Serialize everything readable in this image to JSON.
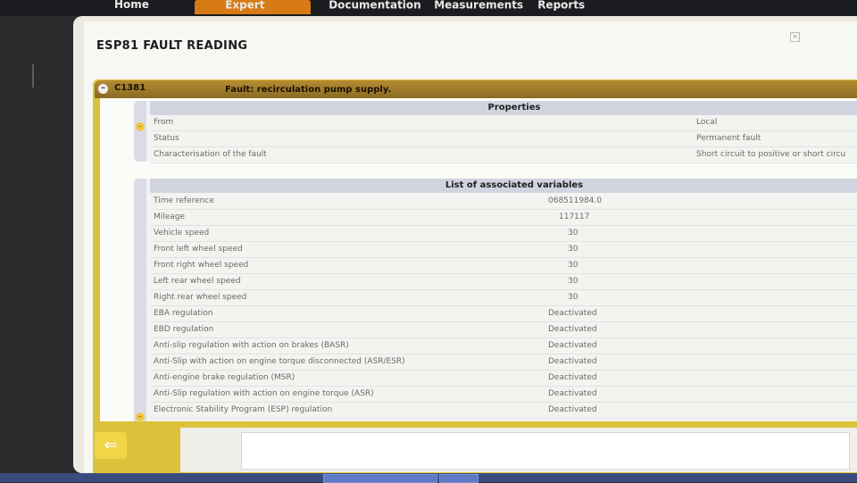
{
  "nav": {
    "tabs": [
      {
        "label": "Home",
        "active": false,
        "icon": "home-icon"
      },
      {
        "label": "Expert",
        "active": true,
        "icon": "expert-icon"
      },
      {
        "label": "Documentation",
        "active": false,
        "icon": "book-icon"
      },
      {
        "label": "Measurements",
        "active": false,
        "icon": "measure-icon"
      },
      {
        "label": "Reports",
        "active": false,
        "icon": "report-icon"
      }
    ]
  },
  "window": {
    "title": "ESP81  FAULT READING"
  },
  "fault": {
    "code": "C1381",
    "description": "Fault: recirculation pump supply."
  },
  "properties": {
    "header": "Properties",
    "rows": [
      {
        "label": "From",
        "value": "Local"
      },
      {
        "label": "Status",
        "value": "Permanent fault"
      },
      {
        "label": "Characterisation of the fault",
        "value": "Short circuit to positive or short circu"
      }
    ]
  },
  "variables": {
    "header": "List of associated variables",
    "rows": [
      {
        "label": "Time reference",
        "value": "068511984.0"
      },
      {
        "label": "Mileage",
        "value": "117117"
      },
      {
        "label": "Vehicle speed",
        "value": "30"
      },
      {
        "label": "Front left wheel speed",
        "value": "30"
      },
      {
        "label": "Front right wheel speed",
        "value": "30"
      },
      {
        "label": "Left rear wheel speed",
        "value": "30"
      },
      {
        "label": "Right rear wheel speed",
        "value": "30"
      },
      {
        "label": "EBA regulation",
        "value": "Deactivated"
      },
      {
        "label": "EBD regulation",
        "value": "Deactivated"
      },
      {
        "label": "Anti-slip regulation with action on brakes (BASR)",
        "value": "Deactivated"
      },
      {
        "label": "Anti-Slip with action on engine torque disconnected (ASR/ESR)",
        "value": "Deactivated"
      },
      {
        "label": "Anti-engine brake regulation (MSR)",
        "value": "Deactivated"
      },
      {
        "label": "Anti-Slip regulation with action on engine torque (ASR)",
        "value": "Deactivated"
      },
      {
        "label": "Electronic Stability Program (ESP) regulation",
        "value": "Deactivated"
      }
    ]
  },
  "footer": {
    "back_icon": "back-arrow-icon",
    "back_glyph": "⇐"
  },
  "colors": {
    "accent": "#d77a16",
    "fault_band": "#dcc23a",
    "header_bar": "#b58c32"
  }
}
